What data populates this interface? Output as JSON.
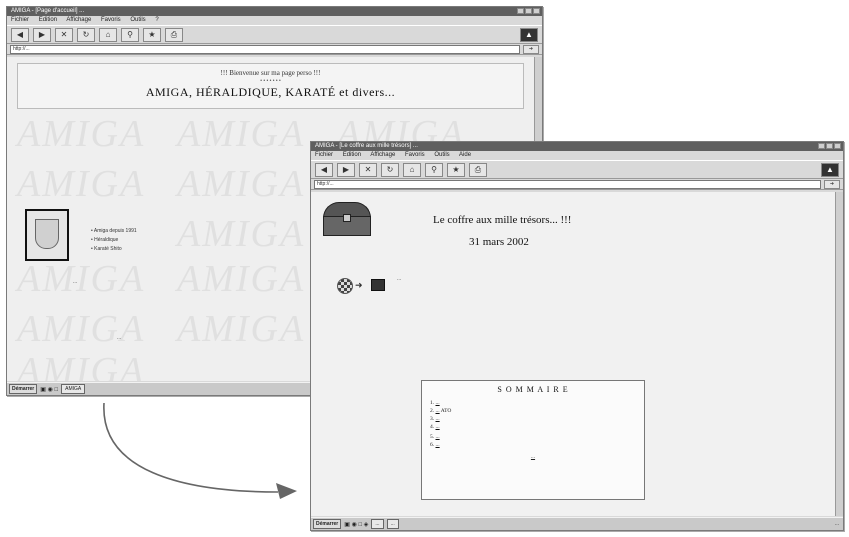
{
  "back_window": {
    "title": "AMIGA - [Page d'accueil] ...",
    "menu": [
      "Fichier",
      "Edition",
      "Affichage",
      "Favoris",
      "Outils",
      "?"
    ],
    "address": "http://...",
    "welcome_line": "!!! Bienvenue sur ma page perso !!!",
    "main_title": "AMIGA, HÉRALDIQUE, KARATÉ et divers...",
    "bg_word": "AMIGA",
    "list_items": [
      "Amiga depuis 1991",
      "Héraldique",
      "Karaté Shito"
    ],
    "paragraph": "...",
    "counter": "...",
    "taskbar_start": "Démarrer",
    "taskbar_task": "AMIGA"
  },
  "front_window": {
    "title": "AMIGA - [Le coffre aux mille trésors] ...",
    "menu": [
      "Fichier",
      "Edition",
      "Affichage",
      "Favoris",
      "Outils",
      "Aide"
    ],
    "address": "http://...",
    "heading": "Le coffre aux mille trésors... !!!",
    "date": "31 mars 2002",
    "intro": "...",
    "sommaire_title": "S O M M A I R E",
    "sommaire_items": [
      {
        "num": "1",
        "link": "...",
        "text": ""
      },
      {
        "num": "2",
        "link": "...",
        "text": "",
        "suffix": "ATO"
      },
      {
        "num": "3",
        "link": "...",
        "text": ""
      },
      {
        "num": "4",
        "link": "...",
        "text": ""
      },
      {
        "num": "5",
        "link": "...",
        "text": ""
      },
      {
        "num": "6",
        "link": "...",
        "text": ""
      }
    ],
    "sommaire_footer": "...",
    "taskbar_start": "Démarrer",
    "taskbar_tasks": [
      "...",
      "..."
    ],
    "taskbar_clock": "..."
  }
}
